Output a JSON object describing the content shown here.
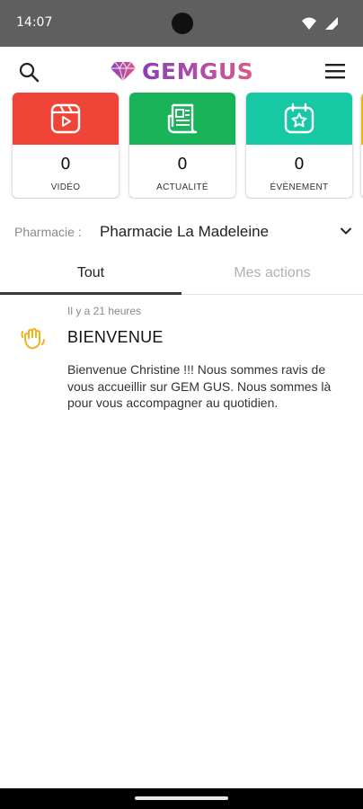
{
  "status_bar": {
    "time": "14:07",
    "icons": [
      "wifi-icon",
      "cell-signal-icon"
    ]
  },
  "header": {
    "logo_text": "GEMGUS",
    "logo_icon": "gem-icon",
    "search_icon": "search-icon",
    "menu_icon": "hamburger-menu-icon"
  },
  "cards": [
    {
      "label": "VIDÉO",
      "count": "0",
      "color": "#f04438",
      "icon": "video-icon"
    },
    {
      "label": "ACTUALITÉ",
      "count": "0",
      "color": "#19b35a",
      "icon": "newspaper-icon"
    },
    {
      "label": "ÉVÈNEMENT",
      "count": "0",
      "color": "#16c9a4",
      "icon": "calendar-star-icon"
    }
  ],
  "pharmacy": {
    "label": "Pharmacie :",
    "value": "Pharmacie La Madeleine"
  },
  "tabs": {
    "all": "Tout",
    "my_actions": "Mes actions",
    "active": "Tout"
  },
  "feed": [
    {
      "time": "Il y a 21 heures",
      "title": "BIENVENUE",
      "body": "Bienvenue Christine !!! Nous sommes ravis de vous accueillir sur GEM GUS. Nous sommes là pour vous accompagner au quotidien.",
      "icon": "waving-hand-icon",
      "icon_color": "#f2b418"
    }
  ]
}
